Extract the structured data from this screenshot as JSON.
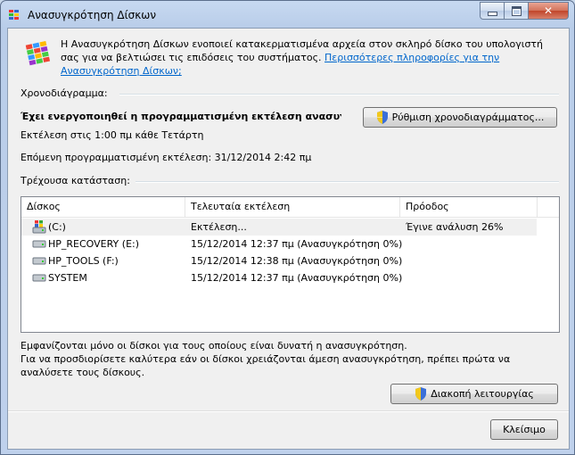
{
  "window": {
    "title": "Ανασυγκρότηση Δίσκων"
  },
  "header": {
    "description": "Η Ανασυγκρότηση Δίσκων ενοποιεί κατακερματισμένα αρχεία στον σκληρό δίσκο του υπολογιστή σας για να βελτιώσει τις επιδόσεις του συστήματος.",
    "more_info_link": "Περισσότερες πληροφορίες για την Ανασυγκρότηση Δίσκων;"
  },
  "schedule": {
    "section_label": "Χρονοδιάγραμμα:",
    "status_bold": "Έχει ενεργοποιηθεί η προγραμματισμένη εκτέλεση ανασυγκρό...",
    "configure_button": "Ρύθμιση χρονοδιαγράμματος...",
    "run_at": "Εκτέλεση στις 1:00 πμ κάθε Τετάρτη",
    "next_run": "Επόμενη προγραμματισμένη εκτέλεση: 31/12/2014 2:42 πμ"
  },
  "current": {
    "section_label": "Τρέχουσα κατάσταση:",
    "columns": [
      "Δίσκος",
      "Τελευταία εκτέλεση",
      "Πρόοδος"
    ],
    "rows": [
      {
        "disk": "(C:)",
        "last_run": "Εκτέλεση...",
        "progress": "Έγινε ανάλυση 26%",
        "icon": "system-drive-icon"
      },
      {
        "disk": "HP_RECOVERY (E:)",
        "last_run": "15/12/2014 12:37 πμ (Ανασυγκρότηση 0%)",
        "progress": "",
        "icon": "hard-drive-icon"
      },
      {
        "disk": "HP_TOOLS (F:)",
        "last_run": "15/12/2014 12:38 πμ (Ανασυγκρότηση 0%)",
        "progress": "",
        "icon": "hard-drive-icon"
      },
      {
        "disk": "SYSTEM",
        "last_run": "15/12/2014 12:37 πμ (Ανασυγκρότηση 0%)",
        "progress": "",
        "icon": "hard-drive-icon"
      }
    ]
  },
  "footer": {
    "info_line1": "Εμφανίζονται μόνο οι δίσκοι για τους οποίους είναι δυνατή η ανασυγκρότηση.",
    "info_line2": "Για να προσδιορίσετε καλύτερα εάν οι δίσκοι χρειάζονται άμεση ανασυγκρότηση, πρέπει πρώτα να αναλύσετε τους δίσκους.",
    "stop_button": "Διακοπή λειτουργίας",
    "close_button": "Κλείσιμο"
  },
  "colors": {
    "link": "#0066cc",
    "title_bar": "#c7d9f1"
  }
}
